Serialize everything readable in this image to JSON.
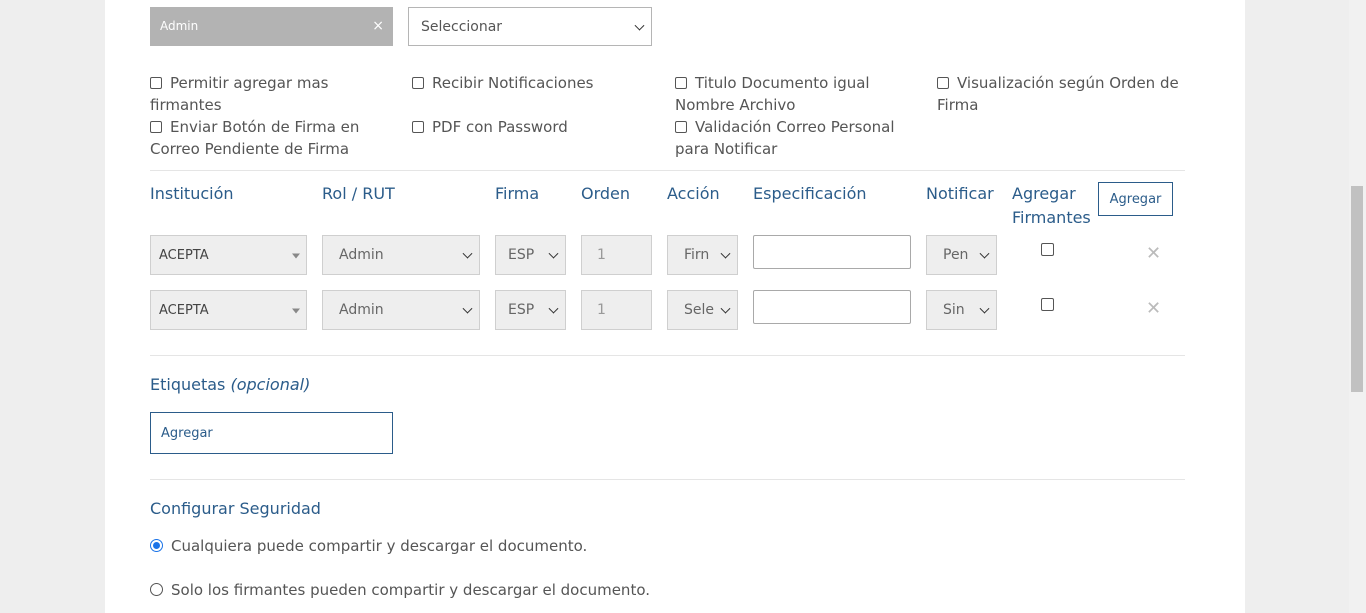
{
  "top": {
    "tag_chip": "Admin",
    "tag_close": "×",
    "select_value": "Seleccionar"
  },
  "options": [
    "Permitir agregar mas firmantes",
    "Recibir Notificaciones",
    "Titulo Documento igual Nombre Archivo",
    "Visualización según Orden de Firma",
    "Enviar Botón de Firma en Correo Pendiente de Firma",
    "PDF con Password",
    "Validación Correo Personal para Notificar"
  ],
  "table": {
    "headers": {
      "institucion": "Institución",
      "rol": "Rol / RUT",
      "firma": "Firma",
      "orden": "Orden",
      "accion": "Acción",
      "especificacion": "Especificación",
      "notificar": "Notificar",
      "agregar_firmantes": "Agregar Firmantes"
    },
    "add_button": "Agregar",
    "rows": [
      {
        "institucion": "ACEPTA",
        "rol": "Admin",
        "firma": "ESP",
        "orden": "1",
        "accion": "Firn",
        "especificacion": "",
        "notificar": "Pen",
        "delete": "✕"
      },
      {
        "institucion": "ACEPTA",
        "rol": "Admin",
        "firma": "ESP",
        "orden": "1",
        "accion": "Sele",
        "especificacion": "",
        "notificar": "Sin",
        "delete": "✕"
      }
    ]
  },
  "etiquetas": {
    "title": "Etiquetas",
    "optional": "(opcional)",
    "input_value": "Agregar"
  },
  "seguridad": {
    "title": "Configurar Seguridad",
    "options": [
      {
        "label": "Cualquiera puede compartir y descargar el documento.",
        "checked": true
      },
      {
        "label": "Solo los firmantes pueden compartir y descargar el documento.",
        "checked": false
      }
    ]
  },
  "colors": {
    "accent": "#2b5c8a",
    "radio_checked": "#1a73e8",
    "chip_bg": "#b3b3b3"
  }
}
